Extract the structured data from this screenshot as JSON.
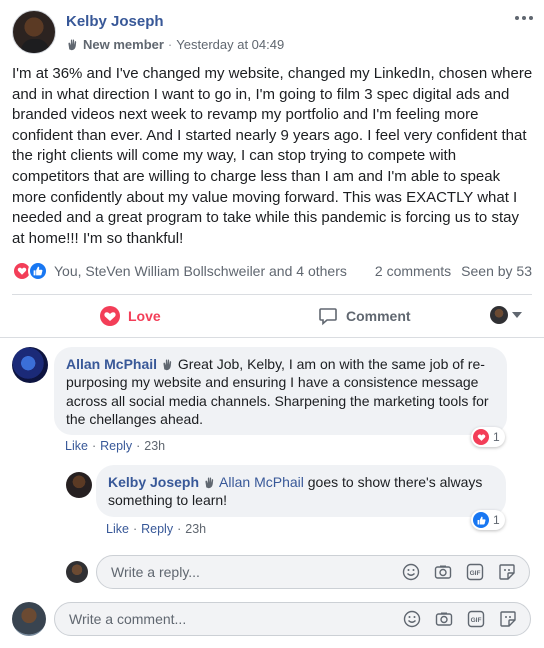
{
  "post": {
    "author": "Kelby Joseph",
    "badge": "New member",
    "separator": "·",
    "timestamp": "Yesterday at 04:49",
    "text": "I'm at 36% and I've changed my website, changed my LinkedIn, chosen where and in what direction I want to go in, I'm going to film 3 spec digital ads and branded videos next week to revamp my portfolio and I'm feeling more confident than ever. And I started nearly 9 years ago. I feel very confident that the right clients will come my way, I can stop trying to compete with competitors that are willing to charge less than I am and I'm able to speak more confidently about my value moving forward. This was EXACTLY what I needed and a great program to take while this pandemic is forcing us to stay at home!!! I'm so thankful!",
    "reactors": "You, SteVen William Bollschweiler and 4 others",
    "comments_count": "2 comments",
    "seen_by": "Seen by 53"
  },
  "actions": {
    "love_label": "Love",
    "comment_label": "Comment"
  },
  "comments": [
    {
      "author": "Allan McPhail",
      "text": "Great Job, Kelby, I am on with the same job of re-purposing my website and ensuring I have a consistence message across all social media channels. Sharpening the marketing tools for the chellanges ahead.",
      "like_label": "Like",
      "reply_label": "Reply",
      "time": "23h",
      "reaction_count": "1"
    },
    {
      "author": "Kelby Joseph",
      "mention": "Allan McPhail",
      "text": "goes to show there's always something to learn!",
      "like_label": "Like",
      "reply_label": "Reply",
      "time": "23h",
      "reaction_count": "1"
    }
  ],
  "reply_input": {
    "placeholder": "Write a reply..."
  },
  "comment_input": {
    "placeholder": "Write a comment..."
  },
  "colors": {
    "link": "#385898",
    "love": "#f33e58",
    "like": "#1877f2",
    "muted": "#606770"
  },
  "icons": [
    "wave-icon",
    "more-icon",
    "love-icon",
    "like-icon",
    "comment-icon",
    "emoji-icon",
    "camera-icon",
    "gif-icon",
    "sticker-icon",
    "chevron-down-icon"
  ]
}
